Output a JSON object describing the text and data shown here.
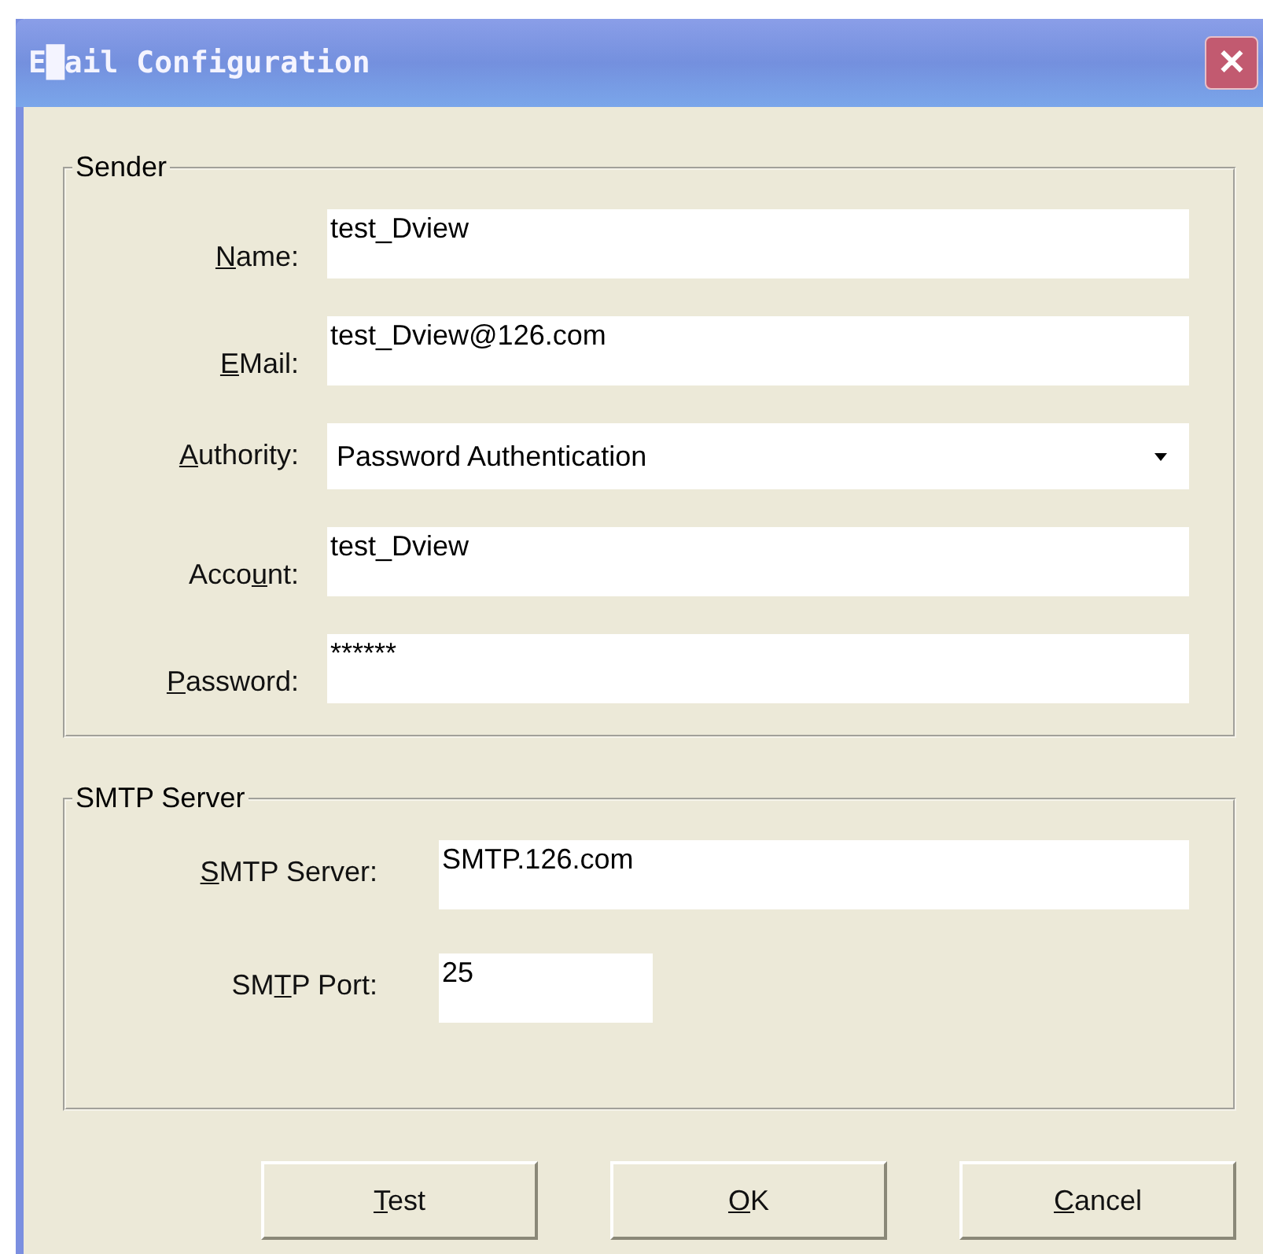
{
  "window": {
    "title": "E█ail Configuration",
    "close": "✕"
  },
  "groups": [
    {
      "title": "Sender",
      "fields": [
        {
          "kind": "text",
          "label": {
            "key": "N",
            "post": "ame:"
          },
          "value": "test_Dview"
        },
        {
          "kind": "text",
          "label": {
            "key": "E",
            "post": "Mail:"
          },
          "value": "test_Dview@126.com"
        },
        {
          "kind": "combo",
          "label": {
            "key": "A",
            "post": "uthority:"
          },
          "value": "Password Authentication"
        },
        {
          "kind": "text",
          "label": {
            "pre": "Acco",
            "key": "u",
            "post": "nt:"
          },
          "value": "test_Dview"
        },
        {
          "kind": "text",
          "label": {
            "key": "P",
            "post": "assword:"
          },
          "value": "******"
        }
      ]
    },
    {
      "title": "SMTP Server",
      "fields": [
        {
          "kind": "text",
          "label": {
            "key": "S",
            "post": "MTP Server:"
          },
          "value": "SMTP.126.com"
        },
        {
          "kind": "short",
          "label": {
            "pre": "SM",
            "key": "T",
            "post": "P Port:"
          },
          "value": "25"
        }
      ]
    }
  ],
  "buttons": [
    {
      "key": "T",
      "post": "est"
    },
    {
      "key": "O",
      "post": "K"
    },
    {
      "key": "C",
      "post": "ancel"
    }
  ]
}
